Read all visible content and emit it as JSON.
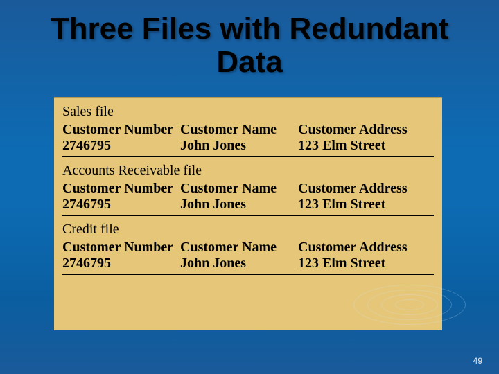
{
  "title": "Three Files with Redundant Data",
  "page_number": "49",
  "records": [
    {
      "file_title": "Sales file",
      "col1_label": "Customer Number",
      "col1_value": "2746795",
      "col2_label": "Customer Name",
      "col2_value": "John Jones",
      "col3_label": "Customer Address",
      "col3_value": "123 Elm Street"
    },
    {
      "file_title": "Accounts Receivable file",
      "col1_label": "Customer Number",
      "col1_value": "2746795",
      "col2_label": "Customer Name",
      "col2_value": "John Jones",
      "col3_label": "Customer Address",
      "col3_value": "123 Elm Street"
    },
    {
      "file_title": "Credit file",
      "col1_label": "Customer Number",
      "col1_value": "2746795",
      "col2_label": "Customer Name",
      "col2_value": "John Jones",
      "col3_label": "Customer Address",
      "col3_value": "123 Elm Street"
    }
  ]
}
